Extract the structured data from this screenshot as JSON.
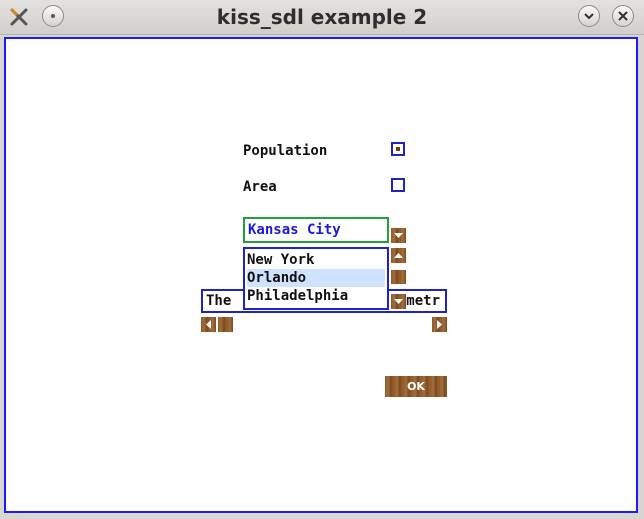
{
  "window": {
    "title": "kiss_sdl example 2"
  },
  "options": {
    "population_label": "Population",
    "area_label": "Area",
    "population_checked": true,
    "area_checked": false
  },
  "combo": {
    "value": "Kansas City"
  },
  "dropdown": {
    "items": [
      "New York",
      "Orlando",
      "Philadelphia"
    ],
    "selected": "Orlando"
  },
  "textbox": {
    "left_text": "The",
    "right_text": "metr"
  },
  "buttons": {
    "ok_label": "OK"
  },
  "colors": {
    "frame": "#1a1aff",
    "combo_border": "#22a03a",
    "combo_text": "#1a1ad8",
    "wood": "#8b5a2b",
    "selection": "#cfe2ff"
  },
  "icons": [
    "app-icon",
    "menu-icon",
    "minimize-icon",
    "close-icon",
    "dropdown-arrow-icon",
    "scroll-up-icon",
    "scroll-down-icon",
    "scroll-left-icon",
    "scroll-right-icon"
  ]
}
